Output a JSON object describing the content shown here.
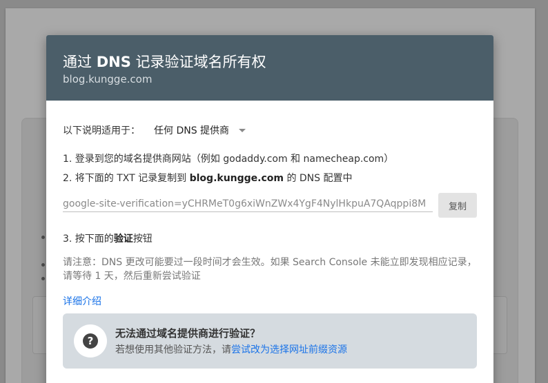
{
  "dialog": {
    "title_pre": "通过 ",
    "title_bold": "DNS",
    "title_post": " 记录验证域名所有权",
    "subtitle": "blog.kungge.com"
  },
  "applies": {
    "label": "以下说明适用于：",
    "selected": "任何 DNS 提供商"
  },
  "steps": {
    "step1": "1. 登录到您的域名提供商网站（例如 godaddy.com 和 namecheap.com）",
    "step2_pre": "2. 将下面的 TXT 记录复制到 ",
    "step2_bold": "blog.kungge.com",
    "step2_post": " 的 DNS 配置中",
    "step3_pre": "3. 按下面的",
    "step3_bold": "验证",
    "step3_post": "按钮"
  },
  "txt_record": {
    "value": "google-site-verification=yCHRMeT0g6xiWnZWx4YgF4NylHkpuA7QAqppi8M",
    "copy_label": "复制"
  },
  "note": "请注意：DNS 更改可能要过一段时间才会生效。如果 Search Console 未能立即发现相应记录，请等待 1 天，然后重新尝试验证",
  "detail_link": "详细介绍",
  "help": {
    "icon": "question-mark-icon",
    "title": "无法通过域名提供商进行验证？",
    "desc_pre": "若想使用其他验证方法，请",
    "desc_link": "尝试改为选择网址前缀资源"
  },
  "colors": {
    "header_bg": "#4b5e69",
    "link": "#1a73e8",
    "help_bg": "#d5dbe0"
  }
}
